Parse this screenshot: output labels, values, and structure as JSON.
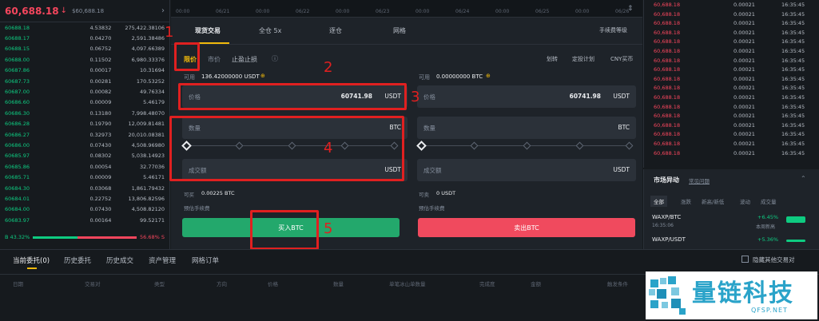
{
  "orderbook": {
    "last_price": "60,688.18",
    "arrow": "↓",
    "usd_price": "$60,688.18",
    "chevron": "›",
    "rows": [
      [
        "60688.18",
        "4.53832",
        "275,422.38106"
      ],
      [
        "60688.17",
        "0.04270",
        "2,591.38486"
      ],
      [
        "60688.15",
        "0.06752",
        "4,097.66389"
      ],
      [
        "60688.00",
        "0.11502",
        "6,980.33376"
      ],
      [
        "60687.86",
        "0.00017",
        "10.31694"
      ],
      [
        "60687.73",
        "0.00281",
        "170.53252"
      ],
      [
        "60687.00",
        "0.00082",
        "49.76334"
      ],
      [
        "60686.60",
        "0.00009",
        "5.46179"
      ],
      [
        "60686.30",
        "0.13180",
        "7,998.48070"
      ],
      [
        "60686.28",
        "0.19790",
        "12,009.81481"
      ],
      [
        "60686.27",
        "0.32973",
        "20,010.08381"
      ],
      [
        "60686.00",
        "0.07430",
        "4,508.96980"
      ],
      [
        "60685.97",
        "0.08302",
        "5,038.14923"
      ],
      [
        "60685.86",
        "0.00054",
        "32.77036"
      ],
      [
        "60685.71",
        "0.00009",
        "5.46171"
      ],
      [
        "60684.30",
        "0.03068",
        "1,861.79432"
      ],
      [
        "60684.01",
        "0.22752",
        "13,806.82596"
      ],
      [
        "60684.00",
        "0.07430",
        "4,508.82120"
      ],
      [
        "60683.97",
        "0.00164",
        "99.52171"
      ]
    ],
    "buy_ratio": "B 43.32%",
    "sell_ratio": "56.68% S",
    "buy_pct": 43.32
  },
  "axis_dates": [
    "00:00",
    "06/21",
    "00:00",
    "06/22",
    "00:00",
    "06/23",
    "00:00",
    "06/24",
    "00:00",
    "06/25",
    "00:00",
    "06/26"
  ],
  "panel": {
    "tabs": [
      "现货交易",
      "全仓 5x",
      "逐仓",
      "网格"
    ],
    "fee_link": "手续费等级",
    "order_types": {
      "limit": "限价",
      "market": "市价",
      "stop": "止盈止损",
      "info_icon": "ⓘ"
    },
    "right_links": [
      "划转",
      "定投计划",
      "CNY买币"
    ],
    "buy": {
      "available_label": "可用",
      "available_value": "136.42000000 USDT",
      "price_label": "价格",
      "price_value": "60741.98",
      "price_unit": "USDT",
      "qty_label": "数量",
      "qty_unit": "BTC",
      "total_label": "成交额",
      "total_unit": "USDT",
      "max_label": "可买",
      "max_value": "0.00225 BTC",
      "fee_label": "预估手续费",
      "button": "买入BTC"
    },
    "sell": {
      "available_label": "可用",
      "available_value": "0.00000000 BTC",
      "price_label": "价格",
      "price_value": "60741.98",
      "price_unit": "USDT",
      "qty_label": "数量",
      "qty_unit": "BTC",
      "total_label": "成交额",
      "total_unit": "USDT",
      "max_label": "可卖",
      "max_value": "0 USDT",
      "fee_label": "预估手续费",
      "button": "卖出BTC"
    }
  },
  "annotations": [
    "1",
    "2",
    "3",
    "4",
    "5"
  ],
  "trades": {
    "rows": [
      [
        "60,688.18",
        "0.00021",
        "16:35:45"
      ],
      [
        "60,688.18",
        "0.00021",
        "16:35:45"
      ],
      [
        "60,688.18",
        "0.00021",
        "16:35:45"
      ],
      [
        "60,688.18",
        "0.00021",
        "16:35:45"
      ],
      [
        "60,688.18",
        "0.00021",
        "16:35:45"
      ],
      [
        "60,688.18",
        "0.00021",
        "16:35:45"
      ],
      [
        "60,688.18",
        "0.00021",
        "16:35:45"
      ],
      [
        "60,688.18",
        "0.00021",
        "16:35:45"
      ],
      [
        "60,688.18",
        "0.00021",
        "16:35:45"
      ],
      [
        "60,688.18",
        "0.00021",
        "16:35:45"
      ],
      [
        "60,688.18",
        "0.00021",
        "16:35:45"
      ],
      [
        "60,688.18",
        "0.00021",
        "16:35:45"
      ],
      [
        "60,688.18",
        "0.00021",
        "16:35:45"
      ],
      [
        "60,688.18",
        "0.00021",
        "16:35:45"
      ],
      [
        "60,688.18",
        "0.00021",
        "16:35:45"
      ],
      [
        "60,688.18",
        "0.00021",
        "16:35:45"
      ],
      [
        "60,688.18",
        "0.00021",
        "16:35:45"
      ]
    ]
  },
  "market": {
    "title": "市场异动",
    "sub": "常见问题",
    "tabs": [
      "全部",
      "涨跌",
      "新高/新低",
      "波动",
      "成交量"
    ],
    "items": [
      {
        "pair": "WAXP/BTC",
        "time": "16:35:06",
        "change": "+6.45%",
        "note": "本周新高"
      },
      {
        "pair": "WAXP/USDT",
        "time": "",
        "change": "+5.36%",
        "note": ""
      }
    ]
  },
  "bottom": {
    "tabs": [
      "当前委托(0)",
      "历史委托",
      "历史成交",
      "资产管理",
      "网格订单"
    ],
    "hide_label": "隐藏其他交易对",
    "columns": [
      "日期",
      "交易对",
      "类型",
      "方向",
      "价格",
      "数量",
      "单笔冰山单数量",
      "完成度",
      "金额",
      "触发条件"
    ]
  },
  "watermark": {
    "name": "量链科技",
    "domain": "QFSP.NET"
  },
  "colors": {
    "green": "#0ecb81",
    "red": "#f6465d",
    "accent": "#f0b90b",
    "annot": "#e02020"
  }
}
